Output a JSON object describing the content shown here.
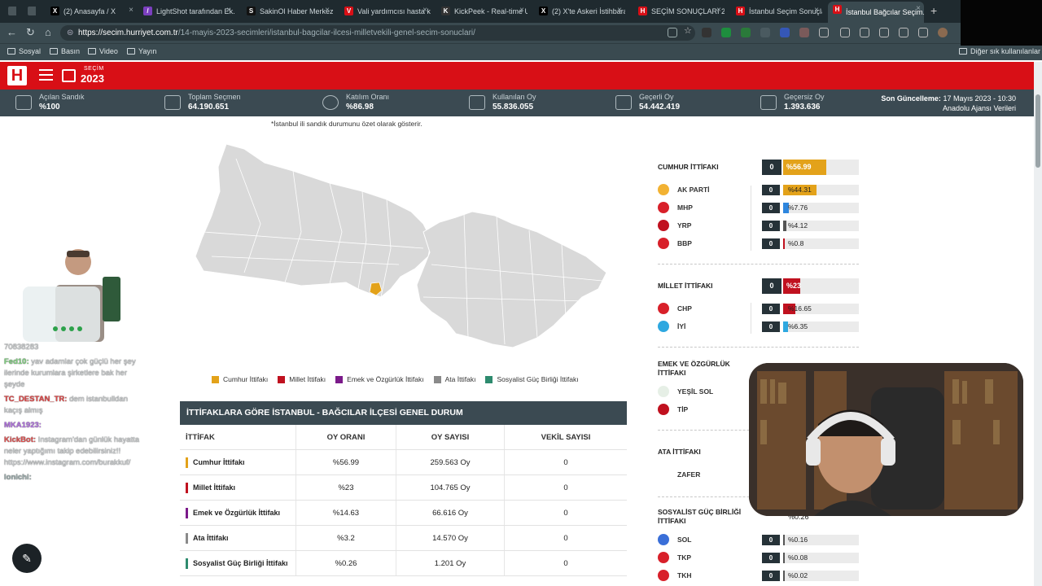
{
  "browser": {
    "tabs": [
      {
        "label": "(2) Anasayfa / X",
        "color": "#000000",
        "glyph": "X"
      },
      {
        "label": "LightShot tarafından Ek...",
        "color": "#7b3fbf",
        "glyph": "/"
      },
      {
        "label": "SakinOl Haber Merkezi",
        "color": "#111111",
        "glyph": "S"
      },
      {
        "label": "Vali yardımcısı hasta kılı...",
        "color": "#d80f16",
        "glyph": "V"
      },
      {
        "label": "KickPeek - Real-time Ul...",
        "color": "#333333",
        "glyph": "K"
      },
      {
        "label": "(2) X'te Askeri İstihbara...",
        "color": "#000000",
        "glyph": "X"
      },
      {
        "label": "SEÇİM SONUÇLARI 2023...",
        "color": "#d80f16",
        "glyph": "H"
      },
      {
        "label": "İstanbul Seçim Sonuçla...",
        "color": "#d80f16",
        "glyph": "H"
      },
      {
        "label": "İstanbul Bağcılar Seçim...",
        "color": "#d80f16",
        "glyph": "H"
      }
    ],
    "url_host": "https://secim.hurriyet.com.tr",
    "url_path": "/14-mayis-2023-secimleri/istanbul-bagcilar-ilcesi-milletvekili-genel-secim-sonuclari/",
    "bookmarks": [
      "Sosyal",
      "Basın",
      "Video",
      "Yayın"
    ],
    "other_bookmarks": "Diğer sık kullanılanlar"
  },
  "site": {
    "logo": "H",
    "brand_small": "SEÇİM",
    "brand_year": "2023"
  },
  "stats": [
    {
      "label": "Açılan Sandık",
      "value": "%100"
    },
    {
      "label": "Toplam Seçmen",
      "value": "64.190.651"
    },
    {
      "label": "Katılım Oranı",
      "value": "%86.98"
    },
    {
      "label": "Kullanılan Oy",
      "value": "55.836.055"
    },
    {
      "label": "Geçerli Oy",
      "value": "54.442.419"
    },
    {
      "label": "Geçersiz Oy",
      "value": "1.393.636"
    }
  ],
  "update": {
    "label": "Son Güncelleme:",
    "value": "17 Mayıs 2023 - 10:30",
    "source": "Anadolu Ajansı Verileri"
  },
  "map_note": "*İstanbul ili sandık durumunu özet olarak gösterir.",
  "legend": [
    {
      "label": "Cumhur İttifakı",
      "color": "#e3a21a"
    },
    {
      "label": "Millet İttifakı",
      "color": "#c0111f"
    },
    {
      "label": "Emek ve Özgürlük İttifakı",
      "color": "#7b1a8a"
    },
    {
      "label": "Ata İttifakı",
      "color": "#8a8a8a"
    },
    {
      "label": "Sosyalist Güç Birliği İttifakı",
      "color": "#2e8b6e"
    }
  ],
  "table": {
    "title": "İTTİFAKLARA GÖRE İSTANBUL - BAĞCILAR İLÇESİ GENEL DURUM",
    "headers": [
      "İTTİFAK",
      "OY ORANI",
      "OY SAYISI",
      "VEKİL SAYISI"
    ],
    "rows": [
      {
        "name": "Cumhur İttifakı",
        "rate": "%56.99",
        "votes": "259.563 Oy",
        "seats": "0",
        "color": "#e3a21a"
      },
      {
        "name": "Millet İttifakı",
        "rate": "%23",
        "votes": "104.765 Oy",
        "seats": "0",
        "color": "#c0111f"
      },
      {
        "name": "Emek ve Özgürlük İttifakı",
        "rate": "%14.63",
        "votes": "66.616 Oy",
        "seats": "0",
        "color": "#7b1a8a"
      },
      {
        "name": "Ata İttifakı",
        "rate": "%3.2",
        "votes": "14.570 Oy",
        "seats": "0",
        "color": "#8a8a8a"
      },
      {
        "name": "Sosyalist Güç Birliği İttifakı",
        "rate": "%0.26",
        "votes": "1.201 Oy",
        "seats": "0",
        "color": "#2e8b6e"
      }
    ]
  },
  "alliances": {
    "cumhur": {
      "title": "CUMHUR İTTİFAKI",
      "seats": "0",
      "pct": "%56.99",
      "fill": 0.5699,
      "color": "#e3a21a"
    },
    "millet": {
      "title": "MİLLET İTTİFAKI",
      "seats": "0",
      "pct": "%23",
      "fill": 0.23,
      "color": "#c0111f"
    },
    "emek": {
      "title": "EMEK VE ÖZGÜRLÜK İTTİFAKI"
    },
    "ata": {
      "title": "ATA İTTİFAKI"
    },
    "sosyalist": {
      "title": "SOSYALİST GÜÇ BİRLİĞİ İTTİFAKI",
      "pct": "%0.26"
    }
  },
  "parties": {
    "akp": {
      "name": "AK PARTİ",
      "seats": "0",
      "pct": "%44.31",
      "fill": 0.4431,
      "color": "#e3a21a"
    },
    "mhp": {
      "name": "MHP",
      "seats": "0",
      "pct": "%7.76",
      "fill": 0.0776,
      "color": "#2e86de"
    },
    "yrp": {
      "name": "YRP",
      "seats": "0",
      "pct": "%4.12",
      "fill": 0.0412,
      "color": "#555555"
    },
    "bbp": {
      "name": "BBP",
      "seats": "0",
      "pct": "%0.8",
      "fill": 0.008,
      "color": "#c0111f"
    },
    "chp": {
      "name": "CHP",
      "seats": "0",
      "pct": "%16.65",
      "fill": 0.1665,
      "color": "#c0111f"
    },
    "iyi": {
      "name": "İYİ",
      "seats": "0",
      "pct": "%6.35",
      "fill": 0.0635,
      "color": "#2ea8e0"
    },
    "ysp": {
      "name": "YEŞİL SOL"
    },
    "tip": {
      "name": "TİP"
    },
    "zafer": {
      "name": "ZAFER"
    },
    "sol": {
      "name": "SOL",
      "seats": "0",
      "pct": "%0.16",
      "fill": 0.0016
    },
    "tkp": {
      "name": "TKP",
      "seats": "0",
      "pct": "%0.08",
      "fill": 0.0008
    },
    "tkh": {
      "name": "TKH",
      "seats": "0",
      "pct": "%0.02",
      "fill": 0.0002
    }
  },
  "chat": [
    {
      "user": "",
      "text": "70838283",
      "color": "#cfd3d5"
    },
    {
      "user": "Fed10:",
      "text": "yav adamlar çok güçlü her şey ilerinde kurumlara şirketlere bak her şeyde",
      "color": "#7fd07f"
    },
    {
      "user": "TC_DESTAN_TR:",
      "text": "dem istanbulldan kaçış almış",
      "color": "#e04848"
    },
    {
      "user": "MKA1923:",
      "text": "",
      "color": "#b070e0"
    },
    {
      "user": "KickBot:",
      "text": "Instagram'dan günlük hayatta neler yaptığımı takip edebilirsiniz!! https://www.instagram.com/burakkuf/",
      "color": "#e05050"
    },
    {
      "user": "lonichi:",
      "text": "",
      "color": "#9aa"
    }
  ],
  "fab_label": "KALEM"
}
